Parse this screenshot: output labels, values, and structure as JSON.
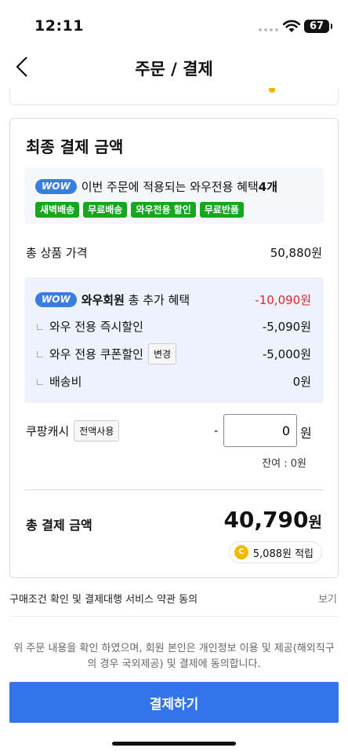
{
  "status": {
    "time": "12:11",
    "battery": "67"
  },
  "header": {
    "title": "주문 / 결제"
  },
  "card": {
    "title": "최종 결제 금액",
    "wow_badge": "WOW",
    "wow_text": "이번 주문에 적용되는 와우전용 혜택",
    "wow_count": "4개",
    "chips": [
      "새벽배송",
      "무료배송",
      "와우전용 할인",
      "무료반품"
    ],
    "product_total_label": "총 상품 가격",
    "product_total_value": "50,880원",
    "member_label": "와우회원",
    "member_label_rest": " 총 추가 혜택",
    "member_total": "-10,090원",
    "instant_label": "와우 전용 즉시할인",
    "instant_value": "-5,090원",
    "coupon_label": "와우 전용 쿠폰할인",
    "coupon_change": "변경",
    "coupon_value": "-5,000원",
    "shipping_label": "배송비",
    "shipping_value": "0원",
    "cash_label": "쿠팡캐시",
    "cash_use_all": "전액사용",
    "cash_dash": "-",
    "cash_input_value": "0",
    "cash_unit": "원",
    "balance": "잔여 : 0원",
    "final_label": "총 결제 금액",
    "final_amount": "40,790",
    "final_unit": "원",
    "points_icon": "C",
    "points_text": "5,088원 적립"
  },
  "terms": {
    "label": "구매조건 확인 및 결제대행 서비스 약관 동의",
    "view": "보기"
  },
  "consent": "위 주문 내용을 확인 하였으며, 회원 본인은 개인정보 이용 및 제공(해외직구의 경우 국외제공) 및 결제에 동의합니다.",
  "pay_button": "결제하기",
  "colors": {
    "accent": "#3474ea",
    "wow": "#3a7de0",
    "chip": "#16a71f",
    "discount": "#e0242e",
    "coin": "#f5b800"
  }
}
